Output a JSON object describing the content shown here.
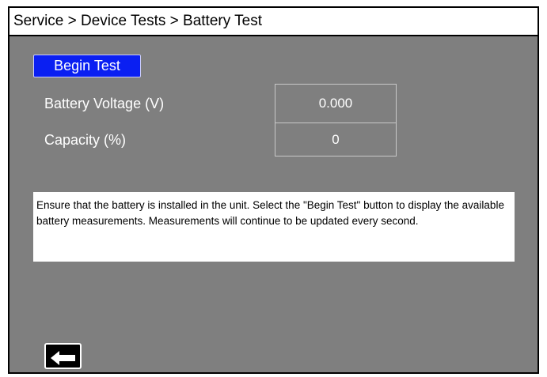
{
  "header": {
    "breadcrumb": "Service > Device Tests > Battery Test"
  },
  "actions": {
    "begin_test_label": "Begin Test"
  },
  "measurements": [
    {
      "label": "Battery Voltage (V)",
      "value": "0.000"
    },
    {
      "label": "Capacity (%)",
      "value": "0"
    }
  ],
  "instructions": {
    "text": "Ensure that the battery is installed in the unit.  Select the \"Begin Test\" button to display the available battery measurements. Measurements will continue to be updated every second."
  },
  "navigation": {
    "back_icon": "arrow-left-icon"
  },
  "colors": {
    "background": "#7f7f7f",
    "accent_button": "#0a1ff2",
    "panel": "#ffffff"
  }
}
